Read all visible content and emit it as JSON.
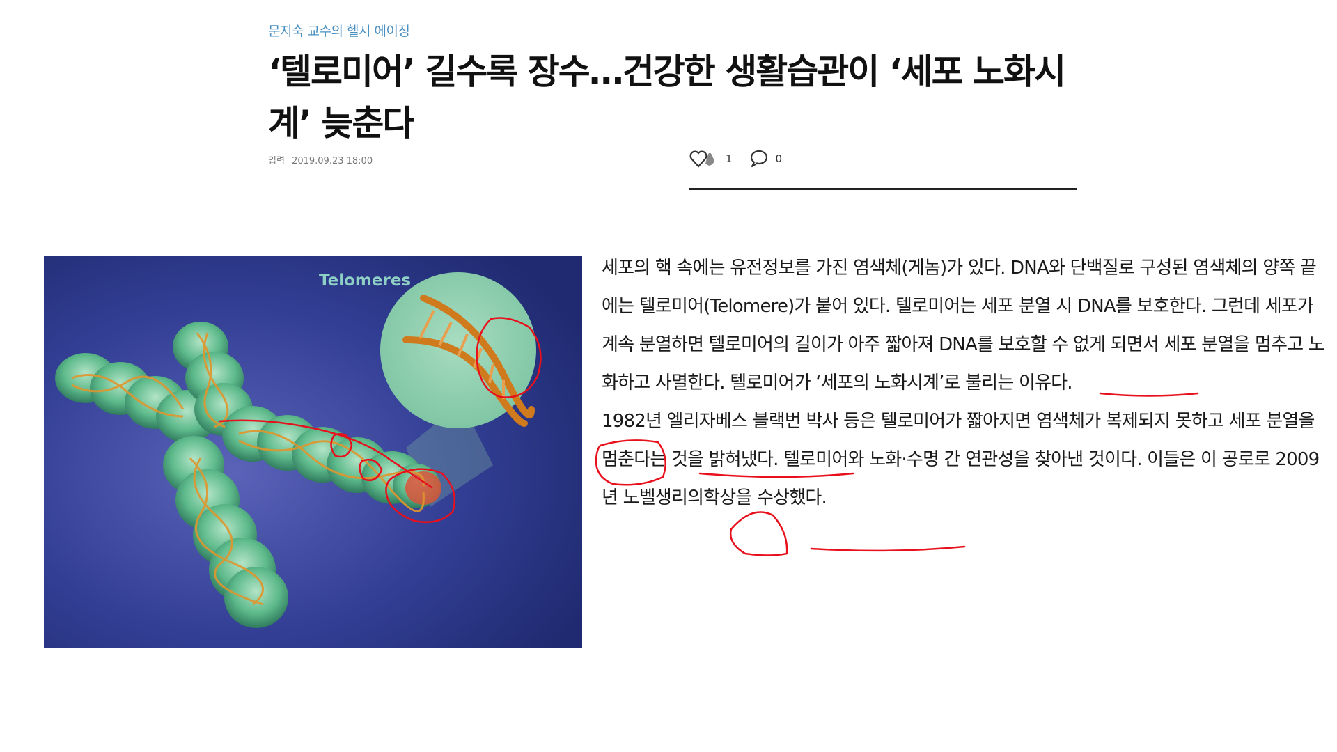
{
  "article": {
    "series": "문지숙 교수의 헬시 에이징",
    "title": "‘텔로미어’ 길수록 장수…건강한 생활습관이 ‘세포 노화시계’ 늦춘다",
    "date_label": "입력",
    "date": "2019.09.23 18:00",
    "likes": "1",
    "comments": "0",
    "paragraph_1": "세포의 핵 속에는 유전정보를 가진 염색체(게놈)가 있다. DNA와 단백질로 구성된 염색체의 양쪽 끝에는 텔로미어(Telomere)가 붙어 있다. 텔로미어는 세포 분열 시 DNA를 보호한다. 그런데 세포가 계속 분열하면 텔로미어의 길이가 아주 짧아져 DNA를 보호할 수 없게 되면서 세포 분열을 멈추고 노화하고 사멸한다. 텔로미어가 ‘세포의 노화시계’로 불리는 이유다.",
    "paragraph_2": "1982년 엘리자베스 블랙번 박사 등은 텔로미어가 짧아지면 염색체가 복제되지 못하고 세포 분열을 멈춘다는 것을 밝혀냈다. 텔로미어와 노화·수명 간 연관성을 찾아낸 것이다. 이들은 이 공로로 2009년 노벨생리의학상을 수상했다."
  },
  "figure": {
    "label": "Telomeres"
  },
  "icons": {
    "like": "heart-icon",
    "comment": "speech-bubble-icon"
  },
  "colors": {
    "series_text": "#4a8fc2",
    "annotation": "#e8101c",
    "figure_bg": "#2a3a8a",
    "chromosome": "#4fb47a",
    "dna": "#d98a2a"
  }
}
